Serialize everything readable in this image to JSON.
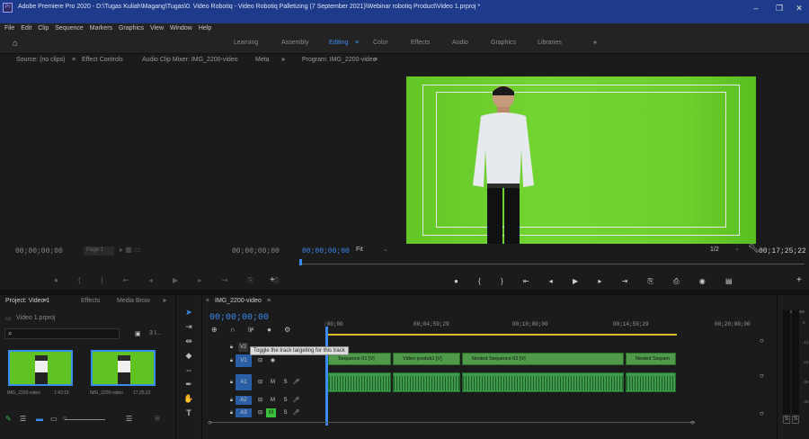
{
  "window": {
    "title": "Adobe Premiere Pro 2020 - D:\\Tugas Kuliah\\Magang\\Tugas\\0. Video Robotiq - Video Robotiq Palletizing (7 September 2021)\\Webinar robotiq Product\\Video 1.prproj *",
    "logo": "Pr",
    "controls": [
      "–",
      "❐",
      "✕"
    ]
  },
  "menu": [
    "File",
    "Edit",
    "Clip",
    "Sequence",
    "Markers",
    "Graphics",
    "View",
    "Window",
    "Help"
  ],
  "workspaces": [
    "Learning",
    "Assembly",
    "Editing",
    "Color",
    "Effects",
    "Audio",
    "Graphics",
    "Libraries",
    "»"
  ],
  "active_workspace": "Editing",
  "source_panel": {
    "tabs": [
      "Source: (no clips)",
      "Effect Controls",
      "Audio Clip Mixer: IMG_2200-video",
      "Meta",
      "»"
    ],
    "timecode_left": "00;00;00;00",
    "page": "Page 1",
    "timecode_right": "00;00;00;00"
  },
  "program_panel": {
    "tab": "Program: IMG_2200-video",
    "timecode": "00;00;00;00",
    "fit": "Fit",
    "resolution": "1/2",
    "duration": "00;17;25;22"
  },
  "project_panel": {
    "tabs": [
      "Project: Video 1",
      "Effects",
      "Media Brow",
      "»"
    ],
    "file": "Video 1.prproj",
    "count": "3 I...",
    "items": [
      {
        "name": "IMG_2200-video",
        "duration": "1:43:15"
      },
      {
        "name": "IMG_2200-video",
        "duration": "17;25;22"
      }
    ]
  },
  "timeline": {
    "tab": "IMG_2200-video",
    "timecode": "00;00;00;00",
    "ruler": [
      ":00;00",
      "00;04;59;29",
      "00;10;00;00",
      "00;14;59;29",
      "00;20;00;00"
    ],
    "tracks": [
      "V2",
      "V1",
      "A1",
      "A2",
      "A3"
    ],
    "tooltip": "Toggle the track targeting for this track",
    "clips": [
      "Sequence 01 [V]",
      "Video produk1 [V]",
      "Nested Sequence 02 [V]",
      "Nested Sequen"
    ]
  },
  "meter": {
    "labels": [
      "0",
      "-12",
      "-24",
      "-36",
      "-48",
      "dB"
    ],
    "solo": [
      "S",
      "S"
    ]
  }
}
